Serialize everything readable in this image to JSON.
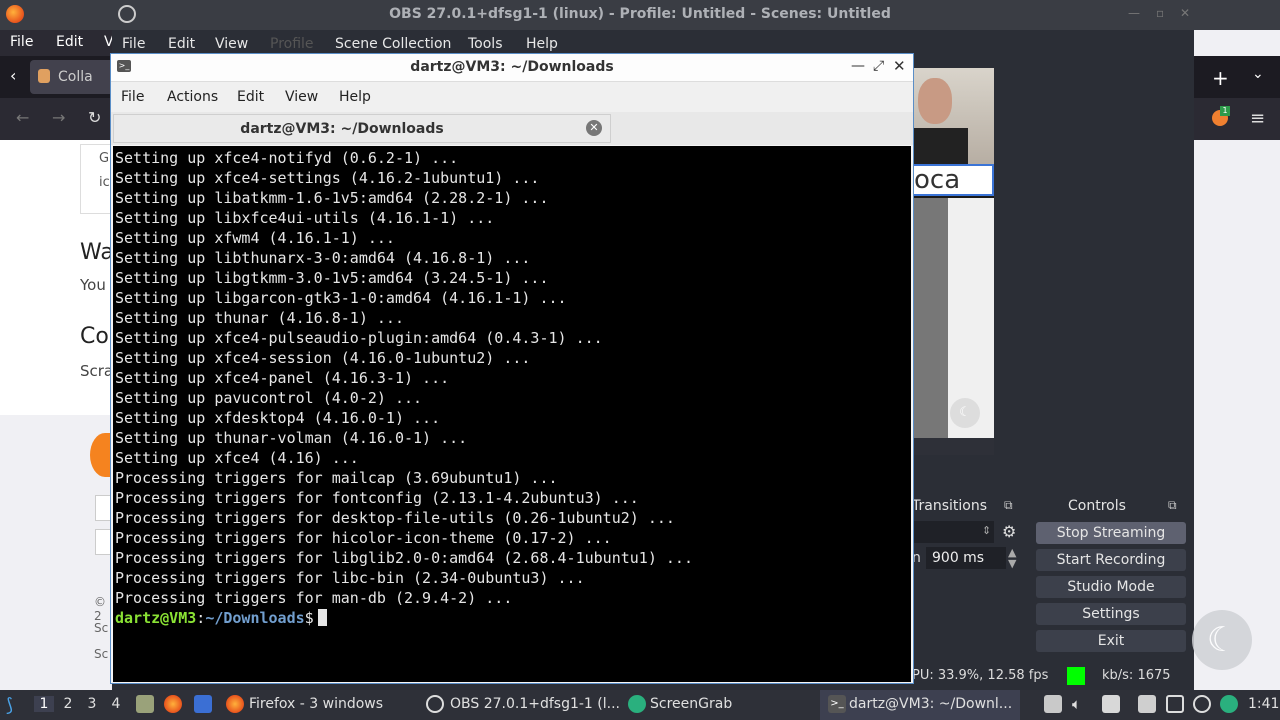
{
  "obs_window": {
    "title": "OBS 27.0.1+dfsg1-1 (linux) - Profile: Untitled - Scenes: Untitled",
    "menu": [
      "File",
      "Edit",
      "View",
      "Profile",
      "Scene Collection",
      "Tools",
      "Help"
    ],
    "transitions_label": "Transitions",
    "duration_value": "900 ms",
    "duration_prefix": "n",
    "controls_label": "Controls",
    "controls": [
      "Stop Streaming",
      "Start Recording",
      "Studio Mode",
      "Settings",
      "Exit"
    ],
    "status_cpu": "PU: 33.9%, 12.58 fps",
    "status_kbs": "kb/s: 1675",
    "preview_text": "oca"
  },
  "firefox_window": {
    "menu": [
      "File",
      "Edit",
      "V"
    ],
    "tab_label": "Colla",
    "page_snippets": [
      "G",
      "ic",
      "Wa",
      "You",
      "Co",
      "Scra",
      "© 2",
      "Sc",
      "Sc"
    ]
  },
  "terminal": {
    "title": "dartz@VM3: ~/Downloads",
    "menu": [
      "File",
      "Actions",
      "Edit",
      "View",
      "Help"
    ],
    "tab_label": "dartz@VM3: ~/Downloads",
    "lines": [
      "Setting up xfce4-notifyd (0.6.2-1) ...",
      "Setting up xfce4-settings (4.16.2-1ubuntu1) ...",
      "Setting up libatkmm-1.6-1v5:amd64 (2.28.2-1) ...",
      "Setting up libxfce4ui-utils (4.16.1-1) ...",
      "Setting up xfwm4 (4.16.1-1) ...",
      "Setting up libthunarx-3-0:amd64 (4.16.8-1) ...",
      "Setting up libgtkmm-3.0-1v5:amd64 (3.24.5-1) ...",
      "Setting up libgarcon-gtk3-1-0:amd64 (4.16.1-1) ...",
      "Setting up thunar (4.16.8-1) ...",
      "Setting up xfce4-pulseaudio-plugin:amd64 (0.4.3-1) ...",
      "Setting up xfce4-session (4.16.0-1ubuntu2) ...",
      "Setting up xfce4-panel (4.16.3-1) ...",
      "Setting up pavucontrol (4.0-2) ...",
      "Setting up xfdesktop4 (4.16.0-1) ...",
      "Setting up thunar-volman (4.16.0-1) ...",
      "Setting up xfce4 (4.16) ...",
      "Processing triggers for mailcap (3.69ubuntu1) ...",
      "Processing triggers for fontconfig (2.13.1-4.2ubuntu3) ...",
      "Processing triggers for desktop-file-utils (0.26-1ubuntu2) ...",
      "Processing triggers for hicolor-icon-theme (0.17-2) ...",
      "Processing triggers for libglib2.0-0:amd64 (2.68.4-1ubuntu1) ...",
      "Processing triggers for libc-bin (2.34-0ubuntu3) ...",
      "Processing triggers for man-db (2.9.4-2) ..."
    ],
    "prompt_user": "dartz@VM3",
    "prompt_sep": ":",
    "prompt_path": "~/Downloads",
    "prompt_symbol": "$"
  },
  "taskbar": {
    "workspaces": [
      "1",
      "2",
      "3",
      "4"
    ],
    "tasks": [
      {
        "label": "Firefox - 3 windows",
        "icon": "firefox-icon"
      },
      {
        "label": "OBS 27.0.1+dfsg1-1 (l...",
        "icon": "obs-icon"
      },
      {
        "label": "ScreenGrab",
        "icon": "screengrab-icon"
      },
      {
        "label": "dartz@VM3: ~/Downl...",
        "icon": "terminal-icon"
      }
    ],
    "clock": "1:41"
  },
  "colors": {
    "terminal_bg": "#000000",
    "prompt_user": "#8ae234",
    "prompt_path": "#729fcf",
    "live_indicator": "#00ff00"
  }
}
